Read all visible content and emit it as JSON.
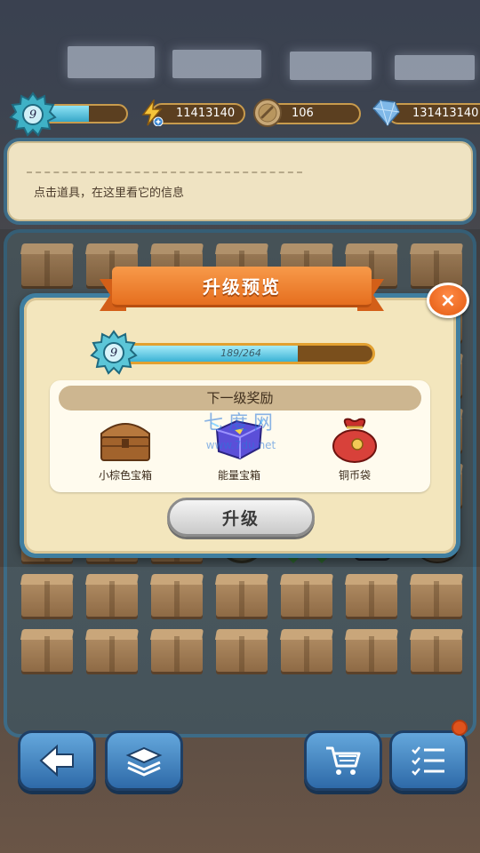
{
  "status_bar": {
    "level": "9",
    "level_progress": 0.6,
    "energy": "11413140",
    "coins": "106",
    "gems": "131413140"
  },
  "info_panel": {
    "text": "点击道具，在这里看它的信息"
  },
  "modal": {
    "title": "升级预览",
    "close_label": "×",
    "level": "9",
    "progress_text": "189/264",
    "progress_value": 189,
    "progress_max": 264,
    "rewards_title": "下一级奖励",
    "rewards": [
      {
        "label": "小棕色宝箱",
        "icon": "brown-chest-icon"
      },
      {
        "label": "能量宝箱",
        "icon": "energy-chest-icon"
      },
      {
        "label": "铜币袋",
        "icon": "coin-bag-icon"
      }
    ],
    "upgrade_label": "升级"
  },
  "watermark": {
    "line1": "七度网",
    "line2": "www.7du.net"
  },
  "toolbar": {
    "back": "back-arrow-icon",
    "layers": "box-layers-icon",
    "shop": "cart-icon",
    "tasks": "checklist-icon"
  },
  "colors": {
    "panel_border": "#3d6b86",
    "ribbon": "#e66f1f",
    "progress": "#3bb2d4",
    "button_blue": "#2e6aa8"
  }
}
